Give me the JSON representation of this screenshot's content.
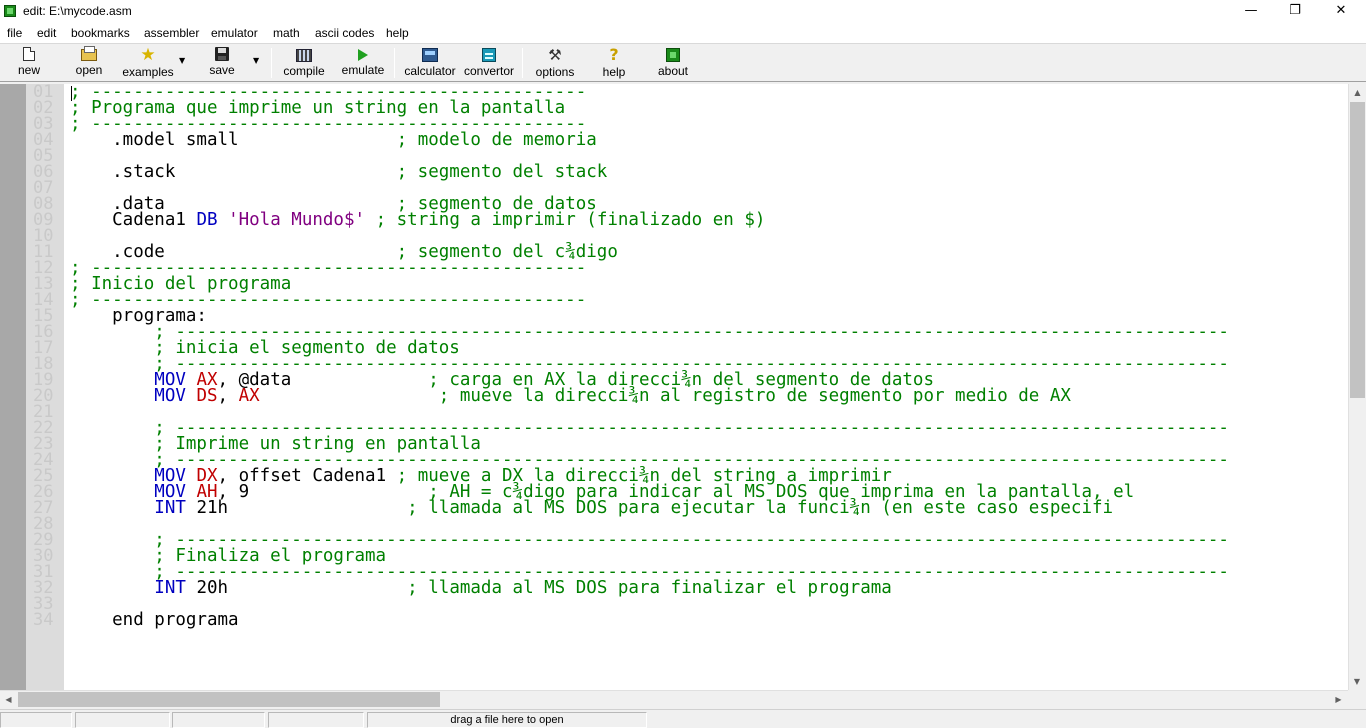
{
  "window": {
    "title": "edit: E:\\mycode.asm",
    "minimize_glyph": "—",
    "maximize_glyph": "❐",
    "close_glyph": "✕"
  },
  "menu": [
    "file",
    "edit",
    "bookmarks",
    "assembler",
    "emulator",
    "math",
    "ascii codes",
    "help"
  ],
  "toolbar": {
    "new": "new",
    "open": "open",
    "examples": "examples",
    "save": "save",
    "compile": "compile",
    "emulate": "emulate",
    "calculator": "calculator",
    "convertor": "convertor",
    "options": "options",
    "help": "help",
    "about": "about",
    "examples_icon": "★",
    "options_icon": "⚒",
    "help_icon": "?",
    "dropdown_glyph": "▼"
  },
  "editor": {
    "line_numbers": [
      "01",
      "02",
      "03",
      "04",
      "05",
      "06",
      "07",
      "08",
      "09",
      "10",
      "11",
      "12",
      "13",
      "14",
      "15",
      "16",
      "17",
      "18",
      "19",
      "20",
      "21",
      "22",
      "23",
      "24",
      "25",
      "26",
      "27",
      "28",
      "29",
      "30",
      "31",
      "32",
      "33",
      "34"
    ],
    "lines": [
      {
        "num": "01",
        "tokens": [
          {
            "t": "; -----------------------------------------------",
            "c": "c"
          }
        ]
      },
      {
        "num": "02",
        "tokens": [
          {
            "t": "; Programa que imprime un string en la pantalla",
            "c": "c"
          }
        ]
      },
      {
        "num": "03",
        "tokens": [
          {
            "t": "; -----------------------------------------------",
            "c": "c"
          }
        ]
      },
      {
        "num": "04",
        "tokens": [
          {
            "t": "    .model small",
            "c": "n"
          },
          {
            "t": "               ; modelo de memoria",
            "c": "c"
          }
        ]
      },
      {
        "num": "06",
        "tokens": [
          {
            "t": "    .stack",
            "c": "n"
          },
          {
            "t": "                     ; segmento del stack",
            "c": "c"
          }
        ]
      },
      {
        "num": "08",
        "tokens": [
          {
            "t": "    .data",
            "c": "n"
          },
          {
            "t": "                      ; segmento de datos",
            "c": "c"
          }
        ]
      },
      {
        "num": "09",
        "tokens": [
          {
            "t": "    Cadena1 ",
            "c": "n"
          },
          {
            "t": "DB",
            "c": "k"
          },
          {
            "t": " ",
            "c": "n"
          },
          {
            "t": "'Hola Mundo$'",
            "c": "s"
          },
          {
            "t": " ; string a imprimir (finalizado en $)",
            "c": "c"
          }
        ]
      },
      {
        "num": "11",
        "tokens": [
          {
            "t": "    .code",
            "c": "n"
          },
          {
            "t": "                      ; segmento del c¾digo",
            "c": "c"
          }
        ]
      },
      {
        "num": "12",
        "tokens": [
          {
            "t": "; -----------------------------------------------",
            "c": "c"
          }
        ]
      },
      {
        "num": "13",
        "tokens": [
          {
            "t": "; Inicio del programa",
            "c": "c"
          }
        ]
      },
      {
        "num": "14",
        "tokens": [
          {
            "t": "; -----------------------------------------------",
            "c": "c"
          }
        ]
      },
      {
        "num": "15",
        "tokens": [
          {
            "t": "    programa:",
            "c": "n"
          }
        ]
      },
      {
        "num": "16",
        "tokens": [
          {
            "t": "        ; ----------------------------------------------------------------------------------------------------",
            "c": "c"
          }
        ]
      },
      {
        "num": "17",
        "tokens": [
          {
            "t": "        ; inicia el segmento de datos",
            "c": "c"
          }
        ]
      },
      {
        "num": "18",
        "tokens": [
          {
            "t": "        ; ----------------------------------------------------------------------------------------------------",
            "c": "c"
          }
        ]
      },
      {
        "num": "19",
        "tokens": [
          {
            "t": "        ",
            "c": "n"
          },
          {
            "t": "MOV",
            "c": "k"
          },
          {
            "t": " ",
            "c": "n"
          },
          {
            "t": "AX",
            "c": "r"
          },
          {
            "t": ", @data",
            "c": "n"
          },
          {
            "t": "             ; carga en AX la direcci¾n del segmento de datos",
            "c": "c"
          }
        ]
      },
      {
        "num": "20",
        "tokens": [
          {
            "t": "        ",
            "c": "n"
          },
          {
            "t": "MOV",
            "c": "k"
          },
          {
            "t": " ",
            "c": "n"
          },
          {
            "t": "DS",
            "c": "r"
          },
          {
            "t": ", ",
            "c": "n"
          },
          {
            "t": "AX",
            "c": "r"
          },
          {
            "t": "                 ; mueve la direcci¾n al registro de segmento por medio de AX",
            "c": "c"
          }
        ]
      },
      {
        "num": "22",
        "tokens": [
          {
            "t": "        ; ----------------------------------------------------------------------------------------------------",
            "c": "c"
          }
        ]
      },
      {
        "num": "23",
        "tokens": [
          {
            "t": "        ; Imprime un string en pantalla",
            "c": "c"
          }
        ]
      },
      {
        "num": "24",
        "tokens": [
          {
            "t": "        ; ----------------------------------------------------------------------------------------------------",
            "c": "c"
          }
        ]
      },
      {
        "num": "25",
        "tokens": [
          {
            "t": "        ",
            "c": "n"
          },
          {
            "t": "MOV",
            "c": "k"
          },
          {
            "t": " ",
            "c": "n"
          },
          {
            "t": "DX",
            "c": "r"
          },
          {
            "t": ", offset Cadena1",
            "c": "n"
          },
          {
            "t": " ; mueve a DX la direcci¾n del string a imprimir",
            "c": "c"
          }
        ]
      },
      {
        "num": "26",
        "tokens": [
          {
            "t": "        ",
            "c": "n"
          },
          {
            "t": "MOV",
            "c": "k"
          },
          {
            "t": " ",
            "c": "n"
          },
          {
            "t": "AH",
            "c": "r"
          },
          {
            "t": ", 9",
            "c": "n"
          },
          {
            "t": "                 ; AH = c¾digo para indicar al MS DOS que imprima en la pantalla, el",
            "c": "c"
          }
        ]
      },
      {
        "num": "27",
        "tokens": [
          {
            "t": "        ",
            "c": "n"
          },
          {
            "t": "INT",
            "c": "k"
          },
          {
            "t": " 21h",
            "c": "n"
          },
          {
            "t": "                 ; llamada al MS DOS para ejecutar la funci¾n (en este caso especifi",
            "c": "c"
          }
        ]
      },
      {
        "num": "29",
        "tokens": [
          {
            "t": "        ; ----------------------------------------------------------------------------------------------------",
            "c": "c"
          }
        ]
      },
      {
        "num": "30",
        "tokens": [
          {
            "t": "        ; Finaliza el programa",
            "c": "c"
          }
        ]
      },
      {
        "num": "31",
        "tokens": [
          {
            "t": "        ; ----------------------------------------------------------------------------------------------------",
            "c": "c"
          }
        ]
      },
      {
        "num": "32",
        "tokens": [
          {
            "t": "        ",
            "c": "n"
          },
          {
            "t": "INT",
            "c": "k"
          },
          {
            "t": " 20h",
            "c": "n"
          },
          {
            "t": "                 ; llamada al MS DOS para finalizar el programa",
            "c": "c"
          }
        ]
      },
      {
        "num": "34",
        "tokens": [
          {
            "t": "    end programa",
            "c": "n"
          }
        ]
      }
    ]
  },
  "scrollbars": {
    "up_glyph": "▲",
    "down_glyph": "▼",
    "left_glyph": "◀",
    "right_glyph": "▶"
  },
  "status": {
    "panels": [
      "",
      "",
      "",
      "",
      "drag a file here to open"
    ]
  },
  "colors": {
    "comment": "#008000",
    "keyword": "#0000c0",
    "register": "#c00000",
    "string": "#800080",
    "gutter_text": "#c9c9c9"
  }
}
